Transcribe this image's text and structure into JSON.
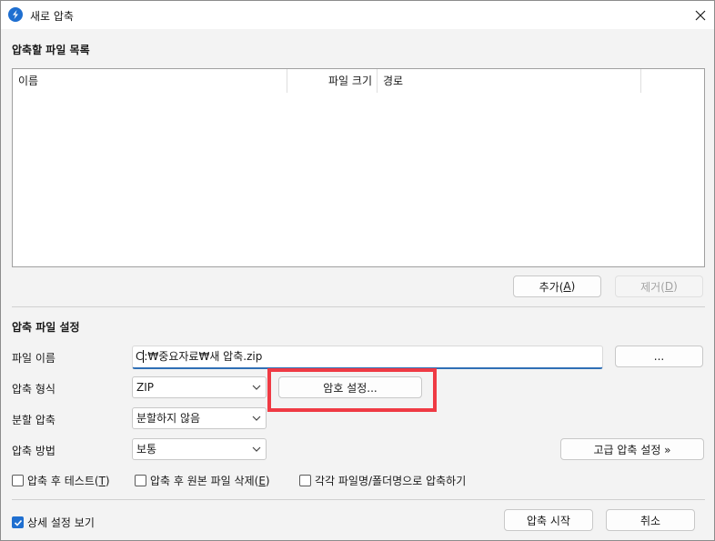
{
  "window": {
    "title": "새로 압축"
  },
  "file_list_section": {
    "title": "압축할 파일 목록",
    "columns": [
      "이름",
      "파일 크기",
      "경로"
    ]
  },
  "list_buttons": {
    "add_label": "추가(",
    "add_key": "A",
    "remove_label": "제거(",
    "remove_key": "D",
    "close_paren": ")"
  },
  "settings_section": {
    "title": "압축 파일 설정",
    "filename_label": "파일 이름",
    "filename_value_prefix": "C",
    "filename_value_suffix": ":₩중요자료₩새 압축.zip",
    "browse_label": "...",
    "format_label": "압축 형식",
    "format_value": "ZIP",
    "password_button": "암호 설정...",
    "split_label": "분할 압축",
    "split_value": "분할하지 않음",
    "method_label": "압축 방법",
    "method_value": "보통",
    "advanced_button": "고급 압축 설정 »"
  },
  "options": {
    "test_label": "압축 후 테스트(",
    "test_key": "T",
    "delete_label": "압축 후 원본 파일 삭제(",
    "delete_key": "E",
    "each_label": "각각 파일명/폴더명으로 압축하기",
    "close_paren": ")"
  },
  "footer": {
    "details_label": "상세 설정 보기",
    "start_button": "압축 시작",
    "cancel_button": "취소"
  },
  "colors": {
    "accent": "#1f6fd0",
    "highlight": "#ef3a44"
  }
}
